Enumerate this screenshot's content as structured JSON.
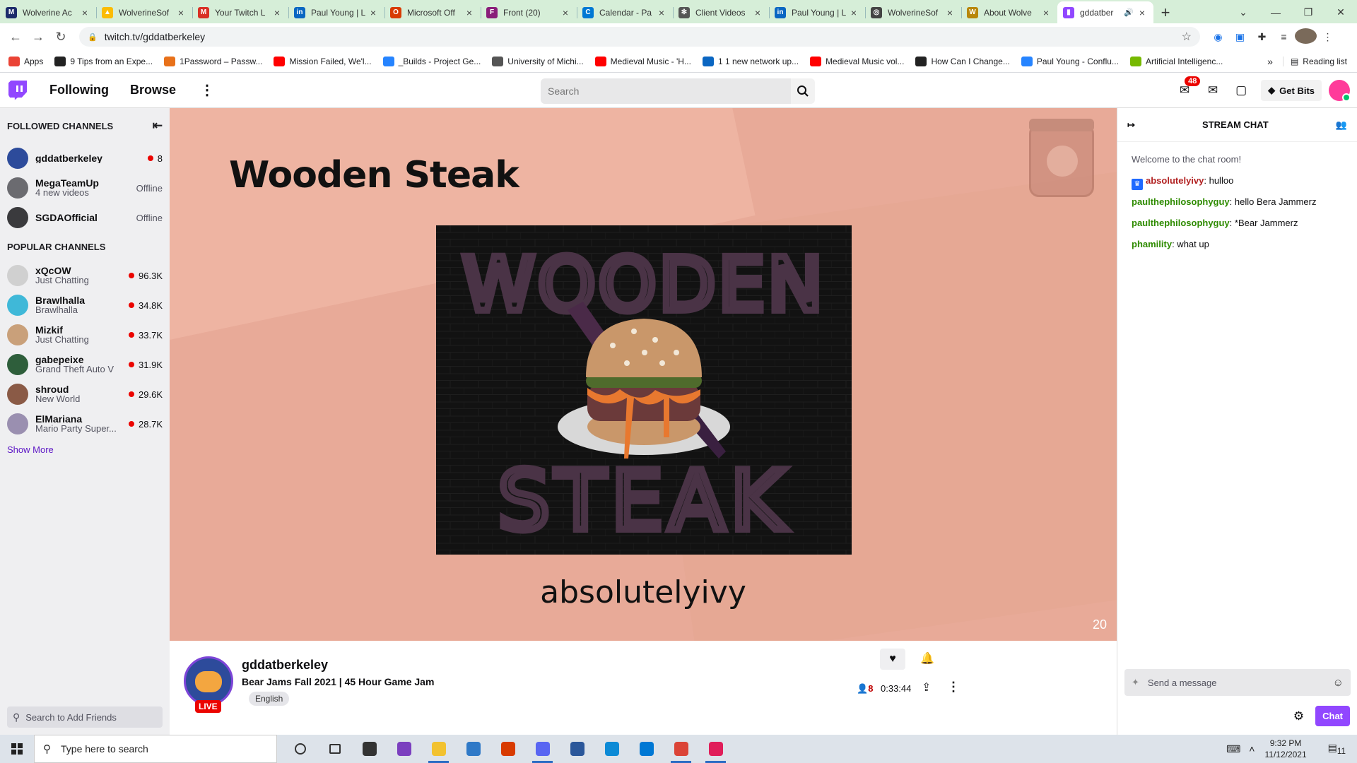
{
  "browser": {
    "tabs": [
      {
        "title": "Wolverine Ac",
        "color": "#1d2c6b",
        "glyph": "M"
      },
      {
        "title": "WolverineSof",
        "color": "#fbbc04",
        "glyph": "▲"
      },
      {
        "title": "Your Twitch L",
        "color": "#d93025",
        "glyph": "M"
      },
      {
        "title": "Paul Young | L",
        "color": "#0a66c2",
        "glyph": "in"
      },
      {
        "title": "Microsoft Off",
        "color": "#d83b01",
        "glyph": "O"
      },
      {
        "title": "Front (20)",
        "color": "#8a1d7a",
        "glyph": "F"
      },
      {
        "title": "Calendar - Pa",
        "color": "#0078d4",
        "glyph": "C"
      },
      {
        "title": "Client Videos",
        "color": "#555555",
        "glyph": "✻"
      },
      {
        "title": "Paul Young | L",
        "color": "#0a66c2",
        "glyph": "in"
      },
      {
        "title": "WolverineSof",
        "color": "#444444",
        "glyph": "◎"
      },
      {
        "title": "About Wolve",
        "color": "#b8860b",
        "glyph": "W"
      },
      {
        "title": "gddatber",
        "color": "#9147ff",
        "glyph": "▮"
      }
    ],
    "url": "twitch.tv/gddatberkeley",
    "bookmarks": [
      {
        "label": "Apps",
        "color": "#ea4335"
      },
      {
        "label": "9 Tips from an Expe...",
        "color": "#222222"
      },
      {
        "label": "1Password – Passw...",
        "color": "#e8711a"
      },
      {
        "label": "Mission Failed, We'l...",
        "color": "#ff0000"
      },
      {
        "label": "_Builds - Project Ge...",
        "color": "#2684ff"
      },
      {
        "label": "University of Michi...",
        "color": "#555555"
      },
      {
        "label": "Medieval Music - 'H...",
        "color": "#ff0000"
      },
      {
        "label": "1 1 new network up...",
        "color": "#0a66c2"
      },
      {
        "label": "Medieval Music vol...",
        "color": "#ff0000"
      },
      {
        "label": "How Can I Change...",
        "color": "#222222"
      },
      {
        "label": "Paul Young - Conflu...",
        "color": "#2684ff"
      },
      {
        "label": "Artificial Intelligenc...",
        "color": "#76b900"
      }
    ],
    "reading_list": "Reading list"
  },
  "twitch_nav": {
    "following": "Following",
    "browse": "Browse",
    "search_placeholder": "Search",
    "inbox_badge": "48",
    "get_bits": "Get Bits"
  },
  "sidebar": {
    "followed_header": "FOLLOWED CHANNELS",
    "followed": [
      {
        "name": "gddatberkeley",
        "sub": "",
        "stat": "8",
        "live": true,
        "color": "#2d4b9b"
      },
      {
        "name": "MegaTeamUp",
        "sub": "4 new videos",
        "stat": "Offline",
        "live": false,
        "color": "#6b6b70"
      },
      {
        "name": "SGDAOfficial",
        "sub": "",
        "stat": "Offline",
        "live": false,
        "color": "#3a3a3d"
      }
    ],
    "popular_header": "POPULAR CHANNELS",
    "popular": [
      {
        "name": "xQcOW",
        "sub": "Just Chatting",
        "stat": "96.3K",
        "live": true,
        "color": "#d0d0d0"
      },
      {
        "name": "Brawlhalla",
        "sub": "Brawlhalla",
        "stat": "34.8K",
        "live": true,
        "color": "#3fb8d8"
      },
      {
        "name": "Mizkif",
        "sub": "Just Chatting",
        "stat": "33.7K",
        "live": true,
        "color": "#c9a07a"
      },
      {
        "name": "gabepeixe",
        "sub": "Grand Theft Auto V",
        "stat": "31.9K",
        "live": true,
        "color": "#2e5e3b"
      },
      {
        "name": "shroud",
        "sub": "New World",
        "stat": "29.6K",
        "live": true,
        "color": "#8a5a46"
      },
      {
        "name": "ElMariana",
        "sub": "Mario Party Super...",
        "stat": "28.7K",
        "live": true,
        "color": "#9a8fb0"
      }
    ],
    "show_more": "Show More",
    "friends_placeholder": "Search to Add Friends"
  },
  "player": {
    "slide_title": "Wooden Steak",
    "art_top": "WOODEN",
    "art_bottom": "STEAK",
    "slide_author": "absolutelyivy",
    "slide_number": "20"
  },
  "stream": {
    "channel": "gddatberkeley",
    "title": "Bear Jams Fall 2021 | 45 Hour Game Jam",
    "tag": "English",
    "live_label": "LIVE",
    "viewers": "8",
    "uptime": "0:33:44"
  },
  "chat": {
    "header": "STREAM CHAT",
    "welcome": "Welcome to the chat room!",
    "messages": [
      {
        "user": "absolutelyivy",
        "text": ": hulloo",
        "color": "#b22222",
        "badge": true
      },
      {
        "user": "paulthephilosophyguy",
        "text": ": hello Bera Jammerz",
        "color": "#2e8b00",
        "badge": false
      },
      {
        "user": "paulthephilosophyguy",
        "text": ": *Bear Jammerz",
        "color": "#2e8b00",
        "badge": false
      },
      {
        "user": "phamility",
        "text": ": what up",
        "color": "#2e8b00",
        "badge": false
      }
    ],
    "input_placeholder": "Send a message",
    "chat_button": "Chat"
  },
  "taskbar": {
    "search_placeholder": "Type here to search",
    "apps": [
      {
        "name": "cortana-icon",
        "color": "#333333"
      },
      {
        "name": "task-view-icon",
        "color": "#333333"
      },
      {
        "name": "store-icon",
        "color": "#333333"
      },
      {
        "name": "github-desktop-icon",
        "color": "#7b3fbf"
      },
      {
        "name": "file-explorer-icon",
        "color": "#f2c230"
      },
      {
        "name": "mail-icon",
        "color": "#2f79c7"
      },
      {
        "name": "office-icon",
        "color": "#d83b01"
      },
      {
        "name": "discord-icon",
        "color": "#5865f2"
      },
      {
        "name": "word-icon",
        "color": "#2b579a"
      },
      {
        "name": "edge-icon",
        "color": "#0c8ad6"
      },
      {
        "name": "vscode-icon",
        "color": "#0078d4"
      },
      {
        "name": "chrome-icon",
        "color": "#db4437"
      },
      {
        "name": "slack-icon",
        "color": "#e01e5a"
      }
    ],
    "time": "9:32 PM",
    "date": "11/12/2021",
    "notification_count": "11"
  }
}
